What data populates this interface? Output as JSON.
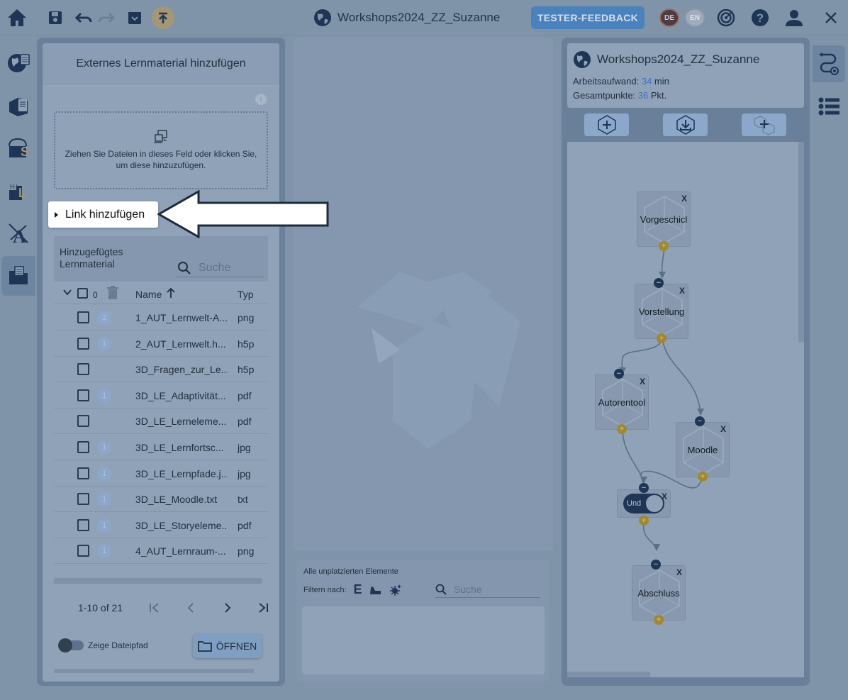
{
  "topbar": {
    "title": "Workshops2024_ZZ_Suzanne",
    "feedback": "TESTER-FEEDBACK",
    "lang_de": "DE",
    "lang_en": "EN",
    "icons": [
      "home-icon",
      "save-icon",
      "undo-icon",
      "redo-icon",
      "archive-icon",
      "upload-icon",
      "globe-icon",
      "target-icon",
      "help-icon",
      "user-icon",
      "close-icon"
    ]
  },
  "leftnav": {
    "items": [
      "world-icon",
      "book-icon",
      "lerninhalte-icon",
      "level-icon",
      "adaptivity-icon",
      "material-folder-icon"
    ]
  },
  "material": {
    "title": "Externes Lernmaterial hinzufügen",
    "info": "i",
    "dropzone_text": "Ziehen Sie Dateien in dieses Feld oder klicken Sie, um diese hinzuzufügen.",
    "link_add": "Link hinzufügen",
    "added_label": "Hinzugefügtes Lernmaterial",
    "search_placeholder": "Suche",
    "selected_count": "0",
    "col_name": "Name",
    "col_type": "Typ",
    "rows": [
      {
        "badge": "2",
        "name": "1_AUT_Lernwelt-A...",
        "type": "png"
      },
      {
        "badge": "1",
        "name": "2_AUT_Lernwelt.h...",
        "type": "h5p"
      },
      {
        "badge": "",
        "name": "3D_Fragen_zur_Le...",
        "type": "h5p"
      },
      {
        "badge": "1",
        "name": "3D_LE_Adaptivität...",
        "type": "pdf"
      },
      {
        "badge": "",
        "name": "3D_LE_Lerneleme...",
        "type": "pdf"
      },
      {
        "badge": "1",
        "name": "3D_LE_Lernfortsc...",
        "type": "jpg"
      },
      {
        "badge": "1",
        "name": "3D_LE_Lernpfade.j...",
        "type": "jpg"
      },
      {
        "badge": "1",
        "name": "3D_LE_Moodle.txt",
        "type": "txt"
      },
      {
        "badge": "1",
        "name": "3D_LE_Storyeleme...",
        "type": "pdf"
      },
      {
        "badge": "1",
        "name": "4_AUT_Lernraum-...",
        "type": "png"
      }
    ],
    "pagination": "1-10 of 21",
    "show_path": "Zeige Dateipfad",
    "open_button": "ÖFFNEN"
  },
  "unplaced": {
    "title": "Alle unplatzierten Elemente",
    "filter_label": "Filtern nach:",
    "filter_e": "E",
    "search_placeholder": "Suche"
  },
  "world": {
    "title": "Workshops2024_ZZ_Suzanne",
    "effort_label": "Arbeitsaufwand: ",
    "effort_value": "34",
    "effort_unit": " min",
    "points_label": "Gesamtpunkte: ",
    "points_value": "36",
    "points_unit": " Pkt.",
    "nodes": [
      {
        "id": "vorgeschichte",
        "label": "Vorgeschicl"
      },
      {
        "id": "vorstellung",
        "label": "Vorstellung"
      },
      {
        "id": "autorentool",
        "label": "Autorentool"
      },
      {
        "id": "moodle",
        "label": "Moodle"
      },
      {
        "id": "abschluss",
        "label": "Abschluss"
      }
    ],
    "condition_label": "Und",
    "node_close": "X"
  },
  "colors": {
    "accent": "#4a82bd",
    "value_blue": "#3f73c2",
    "port_in": "#1f3556",
    "port_out": "#a0882f"
  }
}
